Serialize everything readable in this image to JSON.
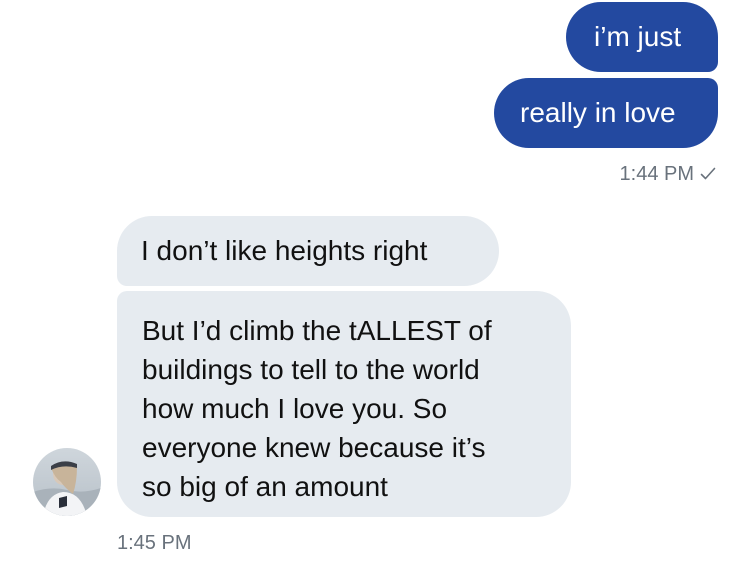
{
  "conversation": {
    "outgoing": {
      "messages": [
        "i’m just",
        "really in love"
      ],
      "timestamp": "1:44 PM",
      "status_icon": "check-icon"
    },
    "incoming": {
      "messages": [
        "I don’t like heights right",
        [
          "But I’d climb the tALLEST of",
          "buildings to tell to the world",
          "how much I love you. So",
          "everyone knew because it’s",
          "so big of an amount"
        ]
      ],
      "timestamp": "1:45 PM",
      "avatar_icon": "user-avatar-photo"
    }
  },
  "colors": {
    "outgoing_bubble": "#2349a0",
    "incoming_bubble": "#e6ebf0",
    "timestamp_text": "#69727c"
  }
}
